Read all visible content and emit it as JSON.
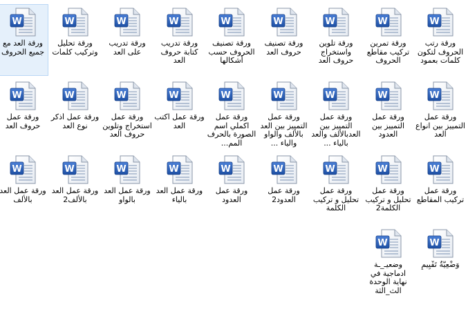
{
  "icon_type": "word-document-icon",
  "accent_color": "#2b5fb4",
  "files": [
    {
      "label": "ورقة رتب الحروف لتكون كلمات بعمود"
    },
    {
      "label": "ورقة تمرين تركيب مقاطع الحروف"
    },
    {
      "label": "ورقة تلوين واستخراج حروف العد"
    },
    {
      "label": "ورقة تصنيف حروف العد"
    },
    {
      "label": "ورقة تصنيف الحروف حسب أشكالها"
    },
    {
      "label": "ورقة تدريب كتابة حروف العد"
    },
    {
      "label": "ورقة تدريب على العد"
    },
    {
      "label": "ورقة تحليل وتركيب كلمات"
    },
    {
      "label": "ورقة العد مع جميع الحروف",
      "selected": true
    },
    {
      "label": "ورقة عمل التمييز بين انواع العد"
    },
    {
      "label": "ورقة عمل التمييز بين العدود"
    },
    {
      "label": "ورقة عمل التمييز بين العدبالألف والعد بالياء ..."
    },
    {
      "label": "ورقة عمل التمييز بين العد بالألف والواو والياء ..."
    },
    {
      "label": "ورقة عمل اكملي اسم الصورة بالحرف المم..."
    },
    {
      "label": "ورقة عمل اكتب العد"
    },
    {
      "label": "ورقة عمل استخراج وتلوين حروف العد"
    },
    {
      "label": "ورقة عمل أذكر نوع العد"
    },
    {
      "label": "ورقة عمل حروف العد"
    },
    {
      "label": "ورقة عمل تركيب المقاطع"
    },
    {
      "label": "ورقة عمل تحليل و تركيب الكلمة2"
    },
    {
      "label": "ورقة عمل تحليل و تركيب الكلمة"
    },
    {
      "label": "ورقة عمل العدود2"
    },
    {
      "label": "ورقة عمل العدود"
    },
    {
      "label": "ورقة عمل العد بالياء"
    },
    {
      "label": "ورقة عمل العد بالواو"
    },
    {
      "label": "ورقة عمل العد بالألف2"
    },
    {
      "label": "ورقة عمل العد بالألف"
    },
    {
      "label": "وَضْعِيَّةٌ تَقْيِيمٍ"
    },
    {
      "label": "وضعيـ_ـة ادماجية في نهاية الوحدة الث_الثة"
    }
  ]
}
